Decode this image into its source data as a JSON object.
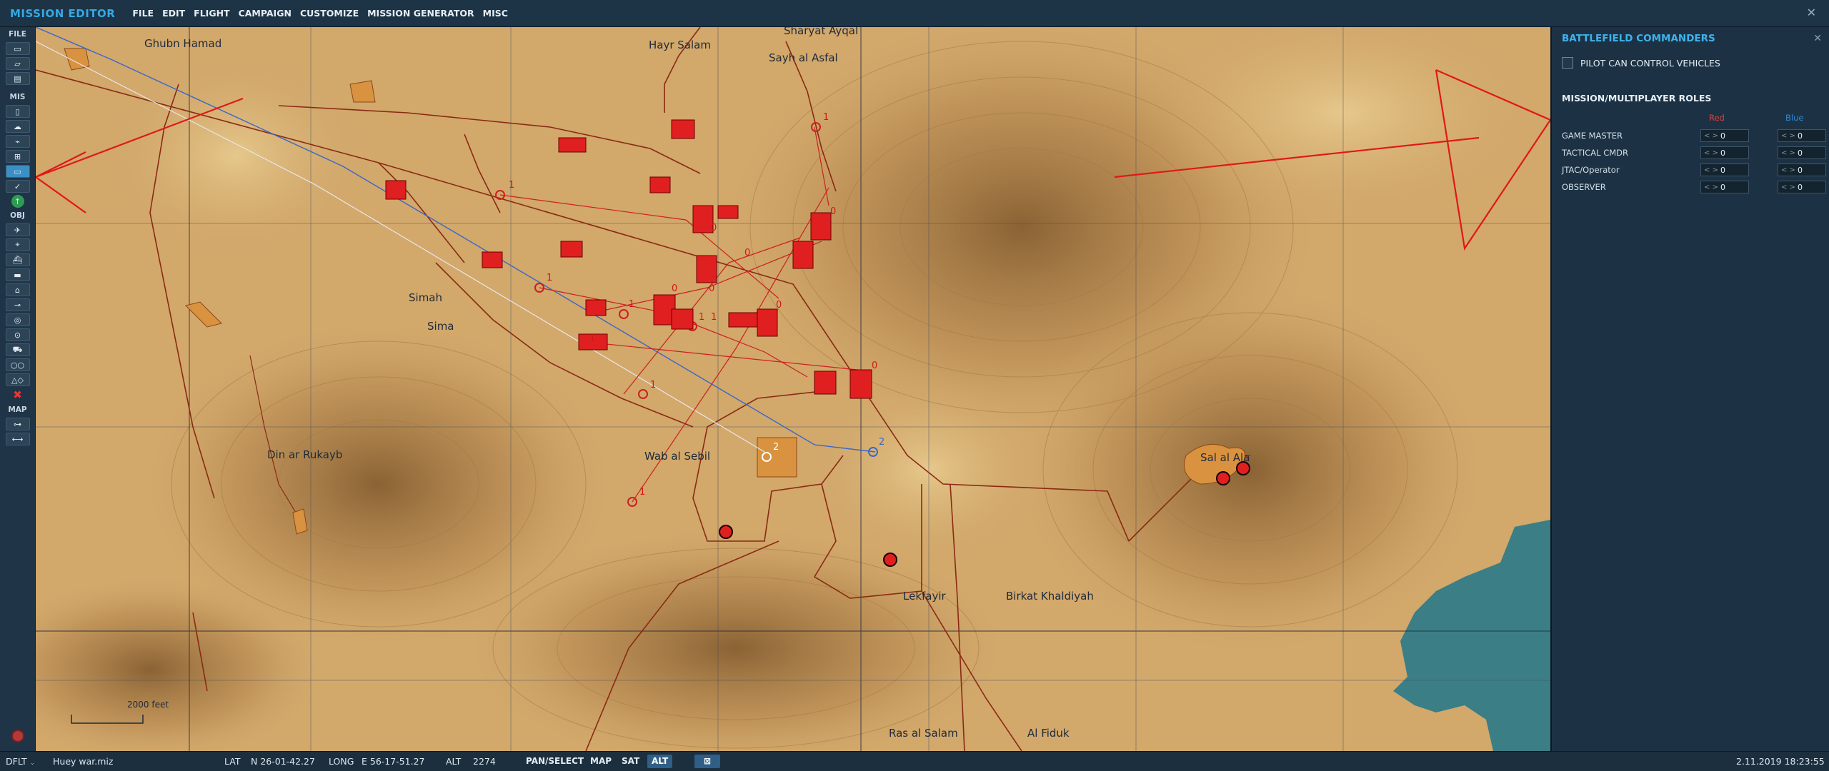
{
  "app": {
    "title": "MISSION EDITOR",
    "menu": [
      "FILE",
      "EDIT",
      "FLIGHT",
      "CAMPAIGN",
      "CUSTOMIZE",
      "MISSION GENERATOR",
      "MISC"
    ],
    "close_glyph": "✕"
  },
  "toolbar": {
    "section_file": "FILE",
    "section_mis": "MIS",
    "section_obj": "OBJ",
    "section_map": "MAP"
  },
  "map": {
    "labels": [
      {
        "id": "ghubn-hamad",
        "text": "Ghubn Hamad"
      },
      {
        "id": "hayr-salam",
        "text": "Hayr Salam"
      },
      {
        "id": "sharyat-aygal",
        "text": "Sharyat Ayqal"
      },
      {
        "id": "sayh-al-asfal",
        "text": "Sayh al Asfal"
      },
      {
        "id": "simah",
        "text": "Simah"
      },
      {
        "id": "sima",
        "text": "Sima"
      },
      {
        "id": "din-ar-rukayb",
        "text": "Din ar Rukayb"
      },
      {
        "id": "wab-al-sebil",
        "text": "Wab al Sebil"
      },
      {
        "id": "sal-al-ala",
        "text": "Sal al Ala"
      },
      {
        "id": "lekfayir",
        "text": "Lekfayir"
      },
      {
        "id": "birkat-khaldiyah",
        "text": "Birkat Khaldiyah"
      },
      {
        "id": "ras-al-salam",
        "text": "Ras al Salam"
      },
      {
        "id": "al-fiduk",
        "text": "Al Fiduk"
      }
    ],
    "scale": "2000 feet",
    "waypoint_numbers": [
      "1",
      "1",
      "1",
      "1",
      "1",
      "1",
      "1",
      "1",
      "1",
      "2",
      "2",
      "0",
      "0",
      "0",
      "0",
      "0",
      "0",
      "0"
    ]
  },
  "panel": {
    "title": "BATTLEFIELD COMMANDERS",
    "close_glyph": "✕",
    "pilot_control_label": "PILOT CAN CONTROL VEHICLES",
    "roles_title": "MISSION/MULTIPLAYER ROLES",
    "col_red": "Red",
    "col_blue": "Blue",
    "color_red": "#e0403a",
    "color_blue": "#2f86d8",
    "roles": [
      {
        "name": "GAME MASTER",
        "red": "0",
        "blue": "0"
      },
      {
        "name": "TACTICAL CMDR",
        "red": "0",
        "blue": "0"
      },
      {
        "name": "JTAC/Operator",
        "red": "0",
        "blue": "0"
      },
      {
        "name": "OBSERVER",
        "red": "0",
        "blue": "0"
      }
    ]
  },
  "status": {
    "profile": "DFLT",
    "file": "Huey war.miz",
    "lat_label": "LAT",
    "lat_value": "N 26-01-42.27",
    "long_label": "LONG",
    "long_value": "E 56-17-51.27",
    "alt_label": "ALT",
    "alt_value": "2274",
    "pan_select": "PAN/SELECT",
    "map_btn": "MAP",
    "sat_btn": "SAT",
    "alt_btn": "ALT",
    "datetime": "2.11.2019 18:23:55"
  }
}
